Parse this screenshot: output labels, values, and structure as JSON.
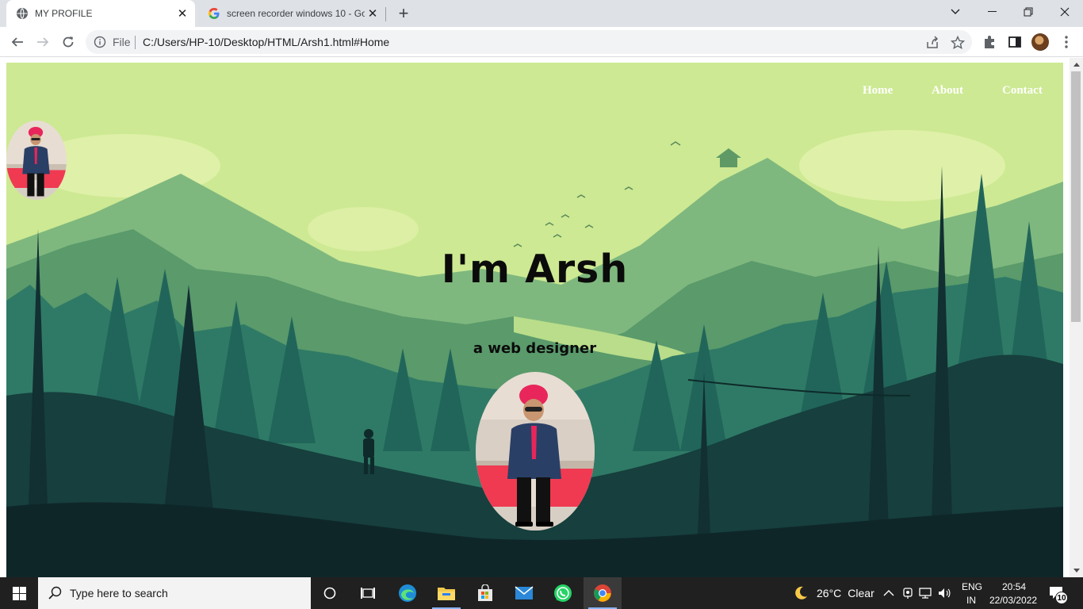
{
  "browser": {
    "tabs": [
      {
        "title": "MY PROFILE",
        "icon": "globe-icon"
      },
      {
        "title": "screen recorder windows 10 - Go",
        "icon": "google-icon"
      }
    ],
    "omnibox": {
      "scheme_label": "File",
      "url": "C:/Users/HP-10/Desktop/HTML/Arsh1.html#Home"
    }
  },
  "page": {
    "nav": {
      "home": "Home",
      "about": "About",
      "contact": "Contact"
    },
    "hero_title": "I'm Arsh",
    "hero_subtitle": "a web designer"
  },
  "taskbar": {
    "search_placeholder": "Type here to search",
    "weather": {
      "temp": "26°C",
      "condition": "Clear"
    },
    "language": {
      "line1": "ENG",
      "line2": "IN"
    },
    "clock": {
      "time": "20:54",
      "date": "22/03/2022"
    },
    "notifications": "10"
  },
  "colors": {
    "sky": "#cde993",
    "nav_text": "#ffffff",
    "taskbar": "#202020",
    "turban": "#e8265b"
  }
}
